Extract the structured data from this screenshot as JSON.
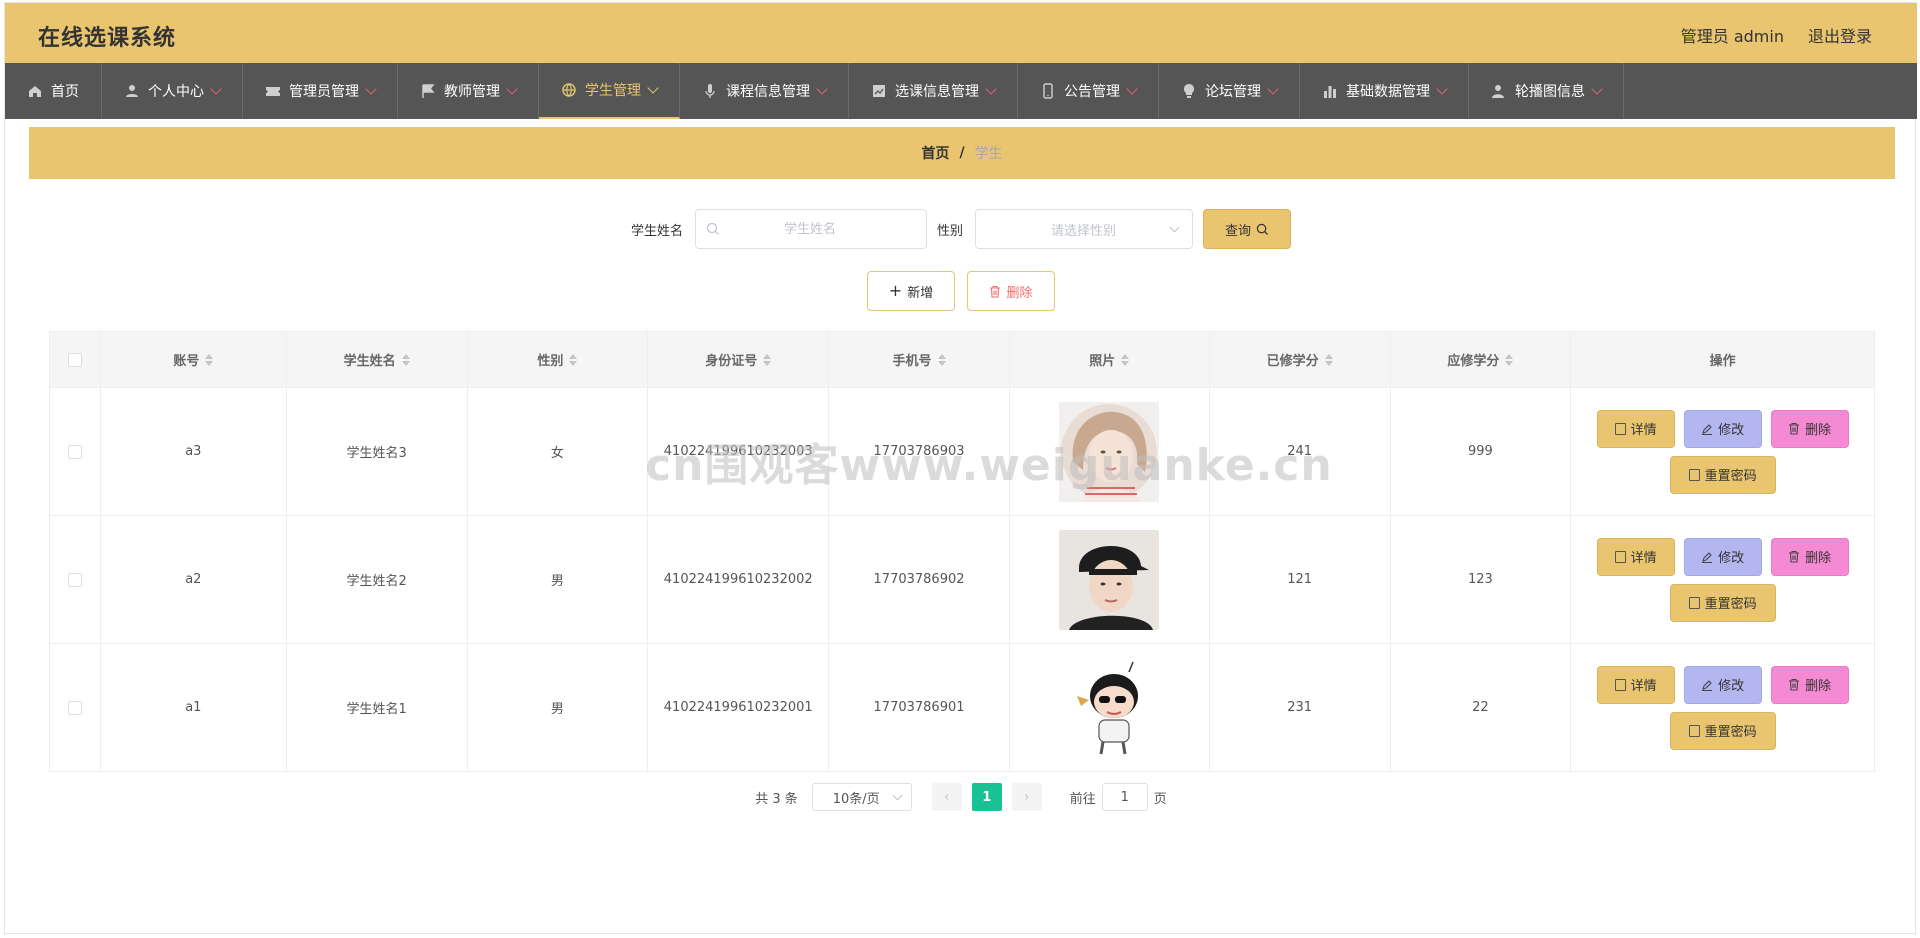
{
  "header": {
    "app_title": "在线选课系统",
    "user_label": "管理员 admin",
    "logout_label": "退出登录"
  },
  "nav": {
    "items": [
      {
        "label": "首页",
        "icon": "home-icon",
        "has_caret": false,
        "active": false
      },
      {
        "label": "个人中心",
        "icon": "user-icon",
        "has_caret": true,
        "active": false
      },
      {
        "label": "管理员管理",
        "icon": "ticket-icon",
        "has_caret": true,
        "active": false
      },
      {
        "label": "教师管理",
        "icon": "flag-icon",
        "has_caret": true,
        "active": false
      },
      {
        "label": "学生管理",
        "icon": "globe-icon",
        "has_caret": true,
        "active": true
      },
      {
        "label": "课程信息管理",
        "icon": "microphone-icon",
        "has_caret": true,
        "active": false
      },
      {
        "label": "选课信息管理",
        "icon": "chart-icon",
        "has_caret": true,
        "active": false
      },
      {
        "label": "公告管理",
        "icon": "phone-icon",
        "has_caret": true,
        "active": false
      },
      {
        "label": "论坛管理",
        "icon": "bulb-icon",
        "has_caret": true,
        "active": false
      },
      {
        "label": "基础数据管理",
        "icon": "bar-chart-icon",
        "has_caret": true,
        "active": false
      },
      {
        "label": "轮播图信息",
        "icon": "user-plus-icon",
        "has_caret": true,
        "active": false
      }
    ]
  },
  "breadcrumb": {
    "home": "首页",
    "sep": "/",
    "current": "学生"
  },
  "search": {
    "name_label": "学生姓名",
    "name_placeholder": "学生姓名",
    "gender_label": "性别",
    "gender_placeholder": "请选择性别",
    "query_label": "查询"
  },
  "actions": {
    "add_label": "新增",
    "delete_label": "删除"
  },
  "table": {
    "headers": [
      "账号",
      "学生姓名",
      "性别",
      "身份证号",
      "手机号",
      "照片",
      "已修学分",
      "应修学分",
      "操作"
    ],
    "rows": [
      {
        "account": "a3",
        "name": "学生姓名3",
        "gender": "女",
        "id_card": "410224199610232003",
        "phone": "17703786903",
        "earned": "241",
        "required": "999"
      },
      {
        "account": "a2",
        "name": "学生姓名2",
        "gender": "男",
        "id_card": "410224199610232002",
        "phone": "17703786902",
        "earned": "121",
        "required": "123"
      },
      {
        "account": "a1",
        "name": "学生姓名1",
        "gender": "男",
        "id_card": "410224199610232001",
        "phone": "17703786901",
        "earned": "231",
        "required": "22"
      }
    ],
    "row_buttons": {
      "detail": "详情",
      "edit": "修改",
      "delete": "删除",
      "reset": "重置密码"
    }
  },
  "pagination": {
    "total": "共 3 条",
    "page_size": "10条/页",
    "current_page": "1",
    "goto_prefix": "前往",
    "goto_value": "1",
    "goto_suffix": "页"
  },
  "watermark": "cn围观客www.weiguanke.cn",
  "colors": {
    "brand": "#e8c56e",
    "nav_bg": "#555555",
    "edit_btn": "#b3b6ef",
    "delete_btn": "#f48ad3",
    "page_active": "#19c294"
  }
}
